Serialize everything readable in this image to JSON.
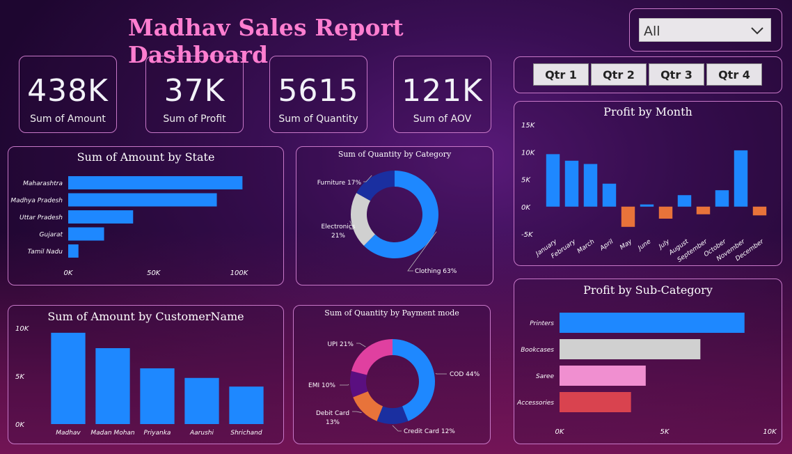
{
  "title": "Madhav Sales Report Dashboard",
  "filter": {
    "selected": "All"
  },
  "quarters": [
    "Qtr 1",
    "Qtr 2",
    "Qtr 3",
    "Qtr 4"
  ],
  "kpis": [
    {
      "value": "438K",
      "label": "Sum of Amount"
    },
    {
      "value": "37K",
      "label": "Sum of Profit"
    },
    {
      "value": "5615",
      "label": "Sum of Quantity"
    },
    {
      "value": "121K",
      "label": "Sum of AOV"
    }
  ],
  "colors": {
    "blue": "#1e88ff",
    "orange": "#e8733a",
    "grey": "#d0d0d0",
    "navy": "#1a2fa0",
    "pink": "#e040a0",
    "purple": "#5a0f80",
    "lightpink": "#f08fd0",
    "red": "#d9434f"
  },
  "chart_data": [
    {
      "id": "state",
      "type": "bar",
      "orientation": "horizontal",
      "title": "Sum of Amount by State",
      "categories": [
        "Maharashtra",
        "Madhya Pradesh",
        "Uttar Pradesh",
        "Gujarat",
        "Tamil Nadu"
      ],
      "values": [
        102000,
        87000,
        38000,
        21000,
        6000
      ],
      "xlim": [
        0,
        110000
      ],
      "ticks": [
        {
          "v": 0,
          "label": "0K"
        },
        {
          "v": 50000,
          "label": "50K"
        },
        {
          "v": 100000,
          "label": "100K"
        }
      ]
    },
    {
      "id": "category",
      "type": "pie",
      "donut": true,
      "title": "Sum of Quantity by Category",
      "slices": [
        {
          "name": "Clothing",
          "value": 63,
          "label": "Clothing 63%",
          "color": "#1e88ff"
        },
        {
          "name": "Electronics",
          "value": 21,
          "label": "Electronics 21%",
          "color": "#d0d0d0"
        },
        {
          "name": "Furniture",
          "value": 17,
          "label": "Furniture 17%",
          "color": "#1a2fa0"
        }
      ]
    },
    {
      "id": "month",
      "type": "bar",
      "title": "Profit by Month",
      "categories": [
        "January",
        "February",
        "March",
        "April",
        "May",
        "June",
        "July",
        "August",
        "September",
        "October",
        "November",
        "December"
      ],
      "values": [
        9600,
        8400,
        7800,
        4200,
        -3700,
        400,
        -2200,
        2100,
        -1400,
        3000,
        10300,
        -1600
      ],
      "ylim": [
        -5000,
        15000
      ],
      "ticks": [
        {
          "v": 15000,
          "label": "15K"
        },
        {
          "v": 10000,
          "label": "10K"
        },
        {
          "v": 5000,
          "label": "5K"
        },
        {
          "v": 0,
          "label": "0K"
        },
        {
          "v": -5000,
          "label": "-5K"
        }
      ]
    },
    {
      "id": "customer",
      "type": "bar",
      "title": "Sum of Amount by CustomerName",
      "categories": [
        "Madhav",
        "Madan Mohan",
        "Priyanka",
        "Aarushi",
        "Shrichand"
      ],
      "values": [
        9500,
        7900,
        5800,
        4800,
        3900
      ],
      "ylim": [
        0,
        10000
      ],
      "ticks": [
        {
          "v": 10000,
          "label": "10K"
        },
        {
          "v": 5000,
          "label": "5K"
        },
        {
          "v": 0,
          "label": "0K"
        }
      ]
    },
    {
      "id": "payment",
      "type": "pie",
      "donut": true,
      "title": "Sum of Quantity by Payment mode",
      "slices": [
        {
          "name": "COD",
          "value": 44,
          "label": "COD 44%",
          "color": "#1e88ff"
        },
        {
          "name": "Credit Card",
          "value": 12,
          "label": "Credit Card 12%",
          "color": "#1a2fa0"
        },
        {
          "name": "Debit Card",
          "value": 13,
          "label": "Debit Card 13%",
          "color": "#e8733a"
        },
        {
          "name": "EMI",
          "value": 10,
          "label": "EMI 10%",
          "color": "#5a0f80"
        },
        {
          "name": "UPI",
          "value": 21,
          "label": "UPI 21%",
          "color": "#e040a0"
        }
      ]
    },
    {
      "id": "subcat",
      "type": "bar",
      "orientation": "horizontal",
      "title": "Profit by Sub-Category",
      "categories": [
        "Printers",
        "Bookcases",
        "Saree",
        "Accessories"
      ],
      "values": [
        8800,
        6700,
        4100,
        3400
      ],
      "colors": [
        "#1e88ff",
        "#d0d0d0",
        "#f08fd0",
        "#d9434f"
      ],
      "xlim": [
        0,
        10000
      ],
      "ticks": [
        {
          "v": 0,
          "label": "0K"
        },
        {
          "v": 5000,
          "label": "5K"
        },
        {
          "v": 10000,
          "label": "10K"
        }
      ]
    }
  ]
}
